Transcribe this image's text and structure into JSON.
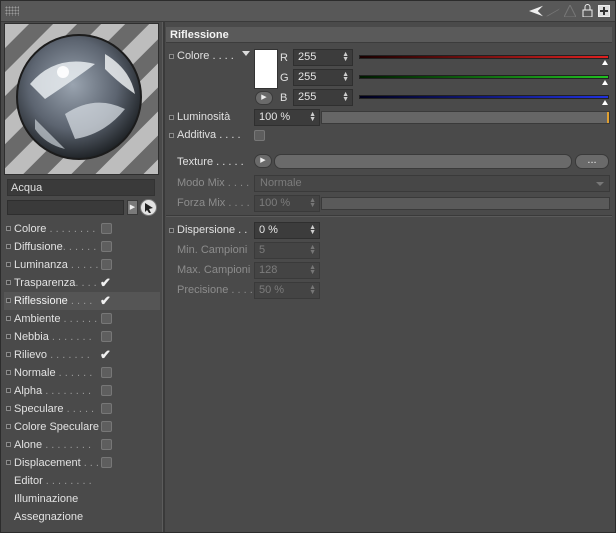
{
  "window": {
    "grip_icon": "grip-icon",
    "toolbar_icons": [
      "arrow-left-icon",
      "arrow-right-icon",
      "up-arrow-icon",
      "lock-icon",
      "new-window-icon"
    ]
  },
  "material": {
    "name": "Acqua"
  },
  "channels": [
    {
      "label": "Colore",
      "dots": " . . . . . . . .",
      "checked": false
    },
    {
      "label": "Diffusione",
      "dots": ". . . . . .",
      "checked": false
    },
    {
      "label": "Luminanza",
      "dots": " . . . . . .",
      "checked": false
    },
    {
      "label": "Trasparenza",
      "dots": ". . . .",
      "checked": true
    },
    {
      "label": "Riflessione",
      "dots": " . . . .",
      "checked": true
    },
    {
      "label": "Ambiente",
      "dots": " . . . . . .",
      "checked": false
    },
    {
      "label": "Nebbia",
      "dots": " . . . . . . .",
      "checked": false
    },
    {
      "label": "Rilievo",
      "dots": " . . . . . . .",
      "checked": true
    },
    {
      "label": "Normale",
      "dots": " . . . . . .",
      "checked": false
    },
    {
      "label": "Alpha",
      "dots": " . . . . . . . .",
      "checked": false
    },
    {
      "label": "Speculare",
      "dots": " . . . . .",
      "checked": false
    },
    {
      "label": "Colore Speculare",
      "dots": "",
      "checked": false
    },
    {
      "label": "Alone",
      "dots": " . . . . . . . .",
      "checked": false
    },
    {
      "label": "Displacement",
      "dots": " . . .",
      "checked": false
    },
    {
      "label": "Editor",
      "dots": " . . . . . . . .",
      "checked": null
    },
    {
      "label": "Illuminazione",
      "dots": "",
      "checked": null
    },
    {
      "label": "Assegnazione",
      "dots": "",
      "checked": null
    }
  ],
  "panel": {
    "title": "Riflessione",
    "colore_label": "Colore  . . . .",
    "r_label": "R",
    "g_label": "G",
    "b_label": "B",
    "r_value": "255",
    "g_value": "255",
    "b_value": "255",
    "swatch_color": "#ffffff",
    "luminosita_label": "Luminosità",
    "luminosita_value": "100 %",
    "luminosita_level_percent": 100,
    "additiva_label": "Additiva  . . . .",
    "texture_label": "Texture  . . . . .",
    "texture_button": "...",
    "modo_mix_label": "Modo Mix  . . . .",
    "modo_mix_value": "Normale",
    "forza_mix_label": "Forza Mix . . . .",
    "forza_mix_value": "100 %",
    "dispersione_label": "Dispersione  . .",
    "dispersione_value": "0 %",
    "min_campioni_label": "Min. Campioni",
    "min_campioni_value": "5",
    "max_campioni_label": "Max. Campioni",
    "max_campioni_value": "128",
    "precisione_label": "Precisione . . . .",
    "precisione_value": "50 %"
  },
  "colors": {
    "red": "#e02020",
    "green": "#20c020",
    "blue": "#2030e0",
    "accent": "#e0a030"
  }
}
